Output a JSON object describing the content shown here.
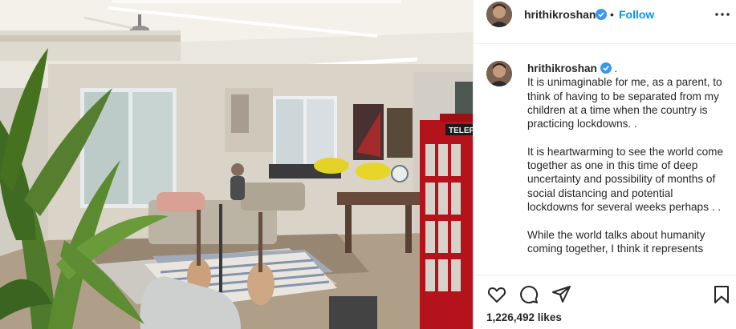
{
  "post": {
    "photo_description": "living-room-photo"
  },
  "header": {
    "username": "hrithikroshan",
    "separator": "•",
    "follow_label": "Follow",
    "more_icon": "more-dots-icon"
  },
  "caption": {
    "username": "hrithikroshan",
    "first_line": ".",
    "paragraphs": [
      "It is unimaginable for me, as a parent, to think of having to be separated from my children at a time when the country is practicing lockdowns. .",
      "It is heartwarming to see the world come together as one in this time of deep uncertainty and possibility of months of social distancing and potential lockdowns for several weeks perhaps . .",
      "While the world talks about humanity coming together, I think it represents"
    ]
  },
  "actions": {
    "icons": [
      "heart-icon",
      "comment-icon",
      "share-icon",
      "bookmark-icon"
    ]
  },
  "likes": {
    "label": "1,226,492 likes"
  },
  "colors": {
    "accent": "#0095f6",
    "verified": "#3897f0",
    "text": "#262626",
    "border": "#efefef"
  }
}
